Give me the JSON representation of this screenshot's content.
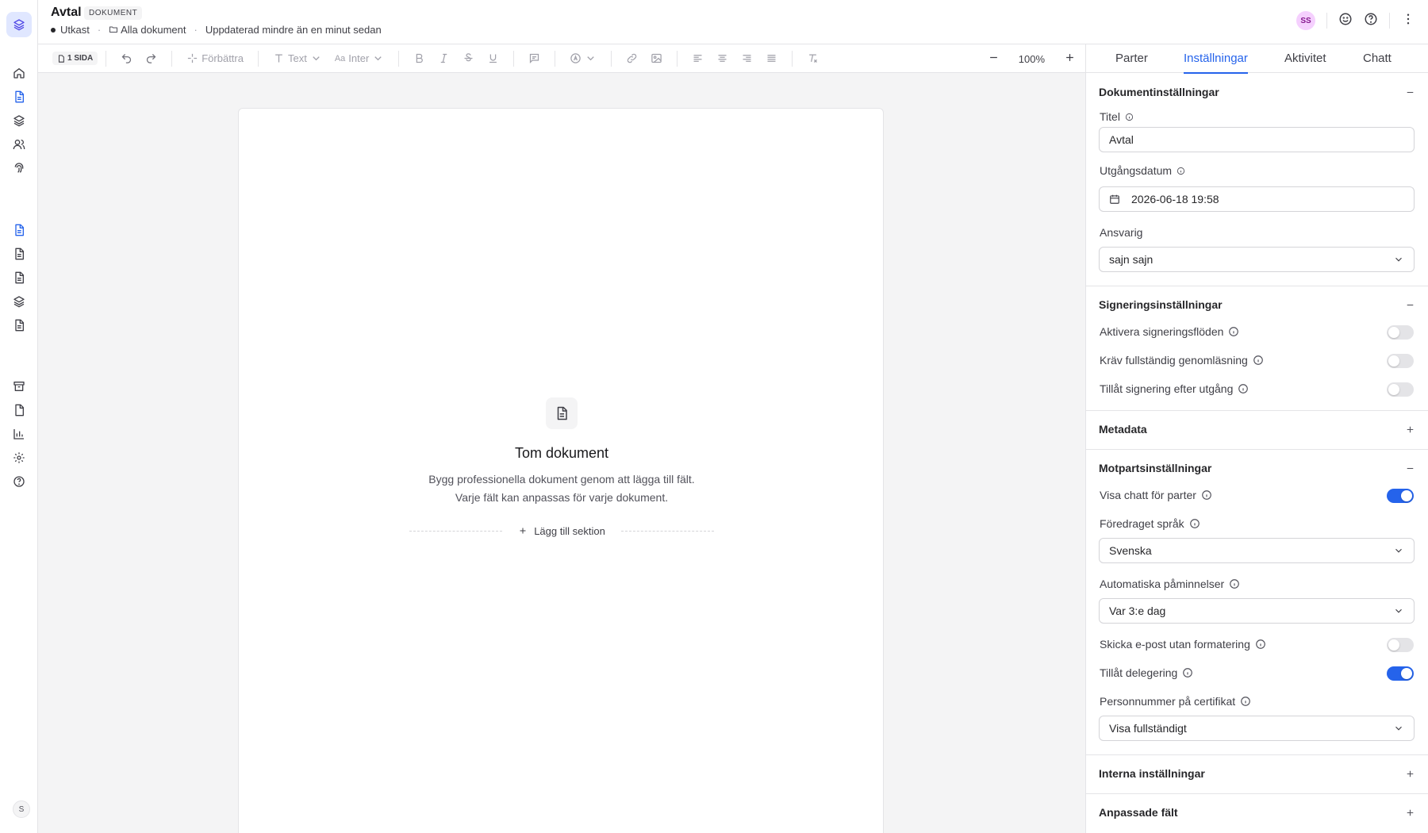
{
  "header": {
    "title": "Avtal",
    "badge": "DOKUMENT",
    "status": "Utkast",
    "folder": "Alla dokument",
    "updated": "Uppdaterad mindre än en minut sedan",
    "avatar": "SS"
  },
  "rail": {
    "user_initial": "S",
    "icons": [
      "layers-logo-icon",
      "home-icon",
      "document-icon",
      "layers-icon",
      "users-icon",
      "fingerprint-icon",
      "document-icon",
      "document-icon",
      "document-icon",
      "layers-icon",
      "document-icon",
      "archive-icon",
      "file-icon",
      "bar-chart-icon",
      "settings-icon",
      "help-icon"
    ]
  },
  "toolbar": {
    "pages": "1 SIDA",
    "improve": "Förbättra",
    "text_style": "Text",
    "font": "Inter",
    "zoom": "100%"
  },
  "canvas": {
    "empty_title": "Tom dokument",
    "empty_description": "Bygg professionella dokument genom att lägga till fält. Varje fält kan anpassas för varje dokument.",
    "add_section": "Lägg till sektion"
  },
  "panel": {
    "tabs": [
      "Parter",
      "Inställningar",
      "Aktivitet",
      "Chatt"
    ],
    "active_tab": "Inställningar",
    "document_settings": {
      "heading": "Dokumentinställningar",
      "title_label": "Titel",
      "title_value": "Avtal",
      "expiry_label": "Utgångsdatum",
      "expiry_value": "2026-06-18 19:58",
      "owner_label": "Ansvarig",
      "owner_value": "sajn sajn"
    },
    "signing_settings": {
      "heading": "Signeringsinställningar",
      "enable_flows": "Aktivera signeringsflöden",
      "enable_flows_on": false,
      "require_full_read": "Kräv fullständig genomläsning",
      "require_full_read_on": false,
      "allow_after_expiry": "Tillåt signering efter utgång",
      "allow_after_expiry_on": false
    },
    "metadata": {
      "heading": "Metadata"
    },
    "counterparty_settings": {
      "heading": "Motpartsinställningar",
      "show_chat": "Visa chatt för parter",
      "show_chat_on": true,
      "language_label": "Föredraget språk",
      "language_value": "Svenska",
      "reminders_label": "Automatiska påminnelser",
      "reminders_value": "Var 3:e dag",
      "plain_email": "Skicka e-post utan formatering",
      "plain_email_on": false,
      "delegation": "Tillåt delegering",
      "delegation_on": true,
      "ssn_label": "Personnummer på certifikat",
      "ssn_value": "Visa fullständigt"
    },
    "internal_settings": {
      "heading": "Interna inställningar"
    },
    "custom_fields": {
      "heading": "Anpassade fält"
    }
  },
  "colors": {
    "accent": "#2563eb",
    "avatar_bg": "#f5d0fe",
    "avatar_fg": "#86198f"
  }
}
